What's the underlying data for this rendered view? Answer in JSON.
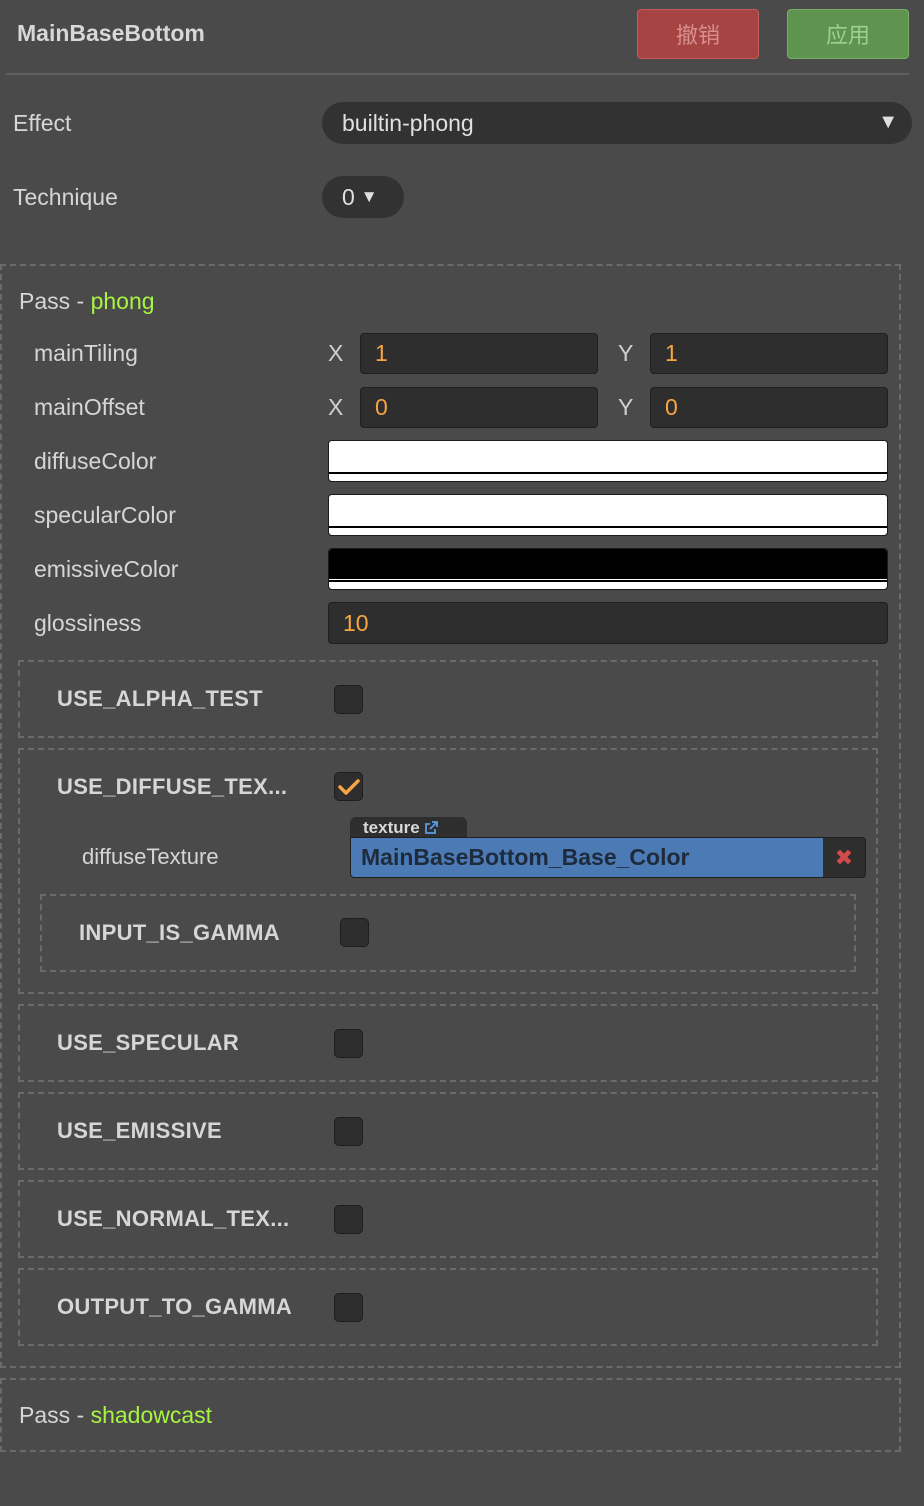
{
  "header": {
    "title": "MainBaseBottom",
    "revert_label": "撤销",
    "apply_label": "应用"
  },
  "effect": {
    "label": "Effect",
    "value": "builtin-phong"
  },
  "technique": {
    "label": "Technique",
    "value": "0"
  },
  "pass_phong": {
    "prefix": "Pass - ",
    "name": "phong",
    "mainTiling": {
      "label": "mainTiling",
      "x_label": "X",
      "x": "1",
      "y_label": "Y",
      "y": "1"
    },
    "mainOffset": {
      "label": "mainOffset",
      "x_label": "X",
      "x": "0",
      "y_label": "Y",
      "y": "0"
    },
    "diffuseColor": {
      "label": "diffuseColor",
      "color": "#ffffff"
    },
    "specularColor": {
      "label": "specularColor",
      "color": "#ffffff"
    },
    "emissiveColor": {
      "label": "emissiveColor",
      "color": "#000000"
    },
    "glossiness": {
      "label": "glossiness",
      "value": "10"
    },
    "macros": {
      "use_alpha_test": {
        "label": "USE_ALPHA_TEST",
        "checked": false
      },
      "use_diffuse_texture": {
        "label": "USE_DIFFUSE_TEX...",
        "checked": true
      },
      "diffuse_texture": {
        "label": "diffuseTexture",
        "tag": "texture",
        "value": "MainBaseBottom_Base_Color",
        "clear": "✖"
      },
      "input_is_gamma": {
        "label": "INPUT_IS_GAMMA",
        "checked": false
      },
      "use_specular": {
        "label": "USE_SPECULAR",
        "checked": false
      },
      "use_emissive": {
        "label": "USE_EMISSIVE",
        "checked": false
      },
      "use_normal_texture": {
        "label": "USE_NORMAL_TEX...",
        "checked": false
      },
      "output_to_gamma": {
        "label": "OUTPUT_TO_GAMMA",
        "checked": false
      }
    }
  },
  "pass_shadowcast": {
    "prefix": "Pass - ",
    "name": "shadowcast"
  },
  "colors": {
    "accent_green": "#a7f441",
    "number_orange": "#f5a543",
    "check_orange": "#f5a543",
    "texture_blue": "#4b7ab4"
  }
}
